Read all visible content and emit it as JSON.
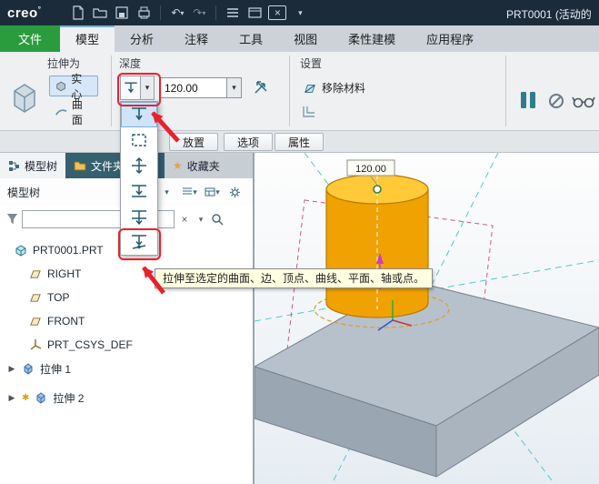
{
  "titlebar": {
    "logo": "creo",
    "logo_mark": "°",
    "document_title": "PRT0001 (活动的"
  },
  "icons": {
    "chevron_down": "▾",
    "undo": "↶",
    "redo": "↷",
    "clear": "×",
    "expander": "▶",
    "asterisk": "✱",
    "star": "★"
  },
  "ribbon_tabs": {
    "file": "文件",
    "items": [
      "模型",
      "分析",
      "注释",
      "工具",
      "视图",
      "柔性建模",
      "应用程序"
    ]
  },
  "dashboard": {
    "extrude_as": {
      "label": "拉伸为",
      "solid": "实心",
      "surface": "曲面"
    },
    "depth": {
      "label": "深度",
      "value": "120.00"
    },
    "settings": {
      "label": "设置",
      "remove_material": "移除材料"
    },
    "tabs": [
      "放置",
      "选项",
      "属性"
    ]
  },
  "depth_menu": {
    "options": [
      "blind",
      "boxed",
      "symmetric",
      "to-next",
      "through-all",
      "to-selected"
    ],
    "selected_index": 0,
    "red_boxed_option": "to-selected"
  },
  "tooltip": {
    "text": "拉伸至选定的曲面、边、顶点、曲线、平面、轴或点。"
  },
  "navigator": {
    "tabs": [
      {
        "label": "模型树"
      },
      {
        "label": "文件夹浏览器"
      },
      {
        "label": "收藏夹"
      }
    ],
    "tree_header": "模型树",
    "filter_value": "",
    "tree": [
      {
        "label": "PRT0001.PRT",
        "icon": "part"
      },
      {
        "label": "RIGHT",
        "icon": "datum-plane"
      },
      {
        "label": "TOP",
        "icon": "datum-plane"
      },
      {
        "label": "FRONT",
        "icon": "datum-plane"
      },
      {
        "label": "PRT_CSYS_DEF",
        "icon": "csys"
      },
      {
        "label": "拉伸 1",
        "icon": "extrude"
      },
      {
        "label": "拉伸 2",
        "icon": "extrude"
      }
    ]
  },
  "viewport": {
    "dimension": "120.00"
  },
  "colors": {
    "accent_green": "#2a9c3e",
    "annotation_red": "#e8212e",
    "highlight_blue": "#cfe4f8",
    "cylinder_orange": "#f0a202"
  }
}
